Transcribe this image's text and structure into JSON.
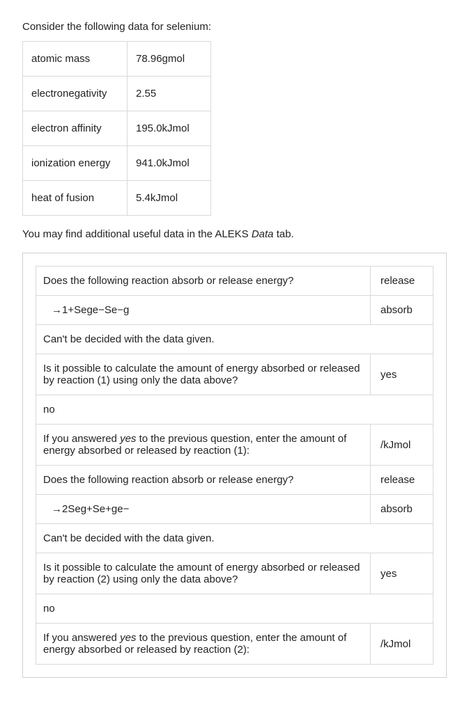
{
  "intro": "Consider the following data for selenium:",
  "properties": [
    {
      "label": "atomic mass",
      "value": "78.96gmol"
    },
    {
      "label": "electronegativity",
      "value": "2.55"
    },
    {
      "label": "electron affinity",
      "value": "195.0kJmol"
    },
    {
      "label": "ionization energy",
      "value": "941.0kJmol"
    },
    {
      "label": "heat of fusion",
      "value": "5.4kJmol"
    }
  ],
  "note_pre": "You may find additional useful data in the ALEKS ",
  "note_italic": "Data",
  "note_post": " tab.",
  "q": {
    "q1": "Does the following reaction absorb or release energy?",
    "r1a": "release",
    "eq1": "→1+Sege−Se−g",
    "r1b": "absorb",
    "cant1": "Can't be decided with the data given.",
    "calc1": "Is it possible to calculate the amount of energy absorbed or released by reaction (1) using only the data above?",
    "yes1": "yes",
    "no1": "no",
    "enter1_pre": "If you answered ",
    "enter1_it": "yes",
    "enter1_post": " to the previous question, enter the amount of energy absorbed or released by reaction (1):",
    "unit1": "/kJmol",
    "q2": "Does the following reaction absorb or release energy?",
    "r2a": "release",
    "eq2": "→2Seg+Se+ge−",
    "r2b": "absorb",
    "cant2": "Can't be decided with the data given.",
    "calc2": "Is it possible to calculate the amount of energy absorbed or released by reaction (2) using only the data above?",
    "yes2": "yes",
    "no2": "no",
    "enter2_pre": "If you answered ",
    "enter2_it": "yes",
    "enter2_post": " to the previous question, enter the amount of energy absorbed or released by reaction (2):",
    "unit2": "/kJmol"
  }
}
